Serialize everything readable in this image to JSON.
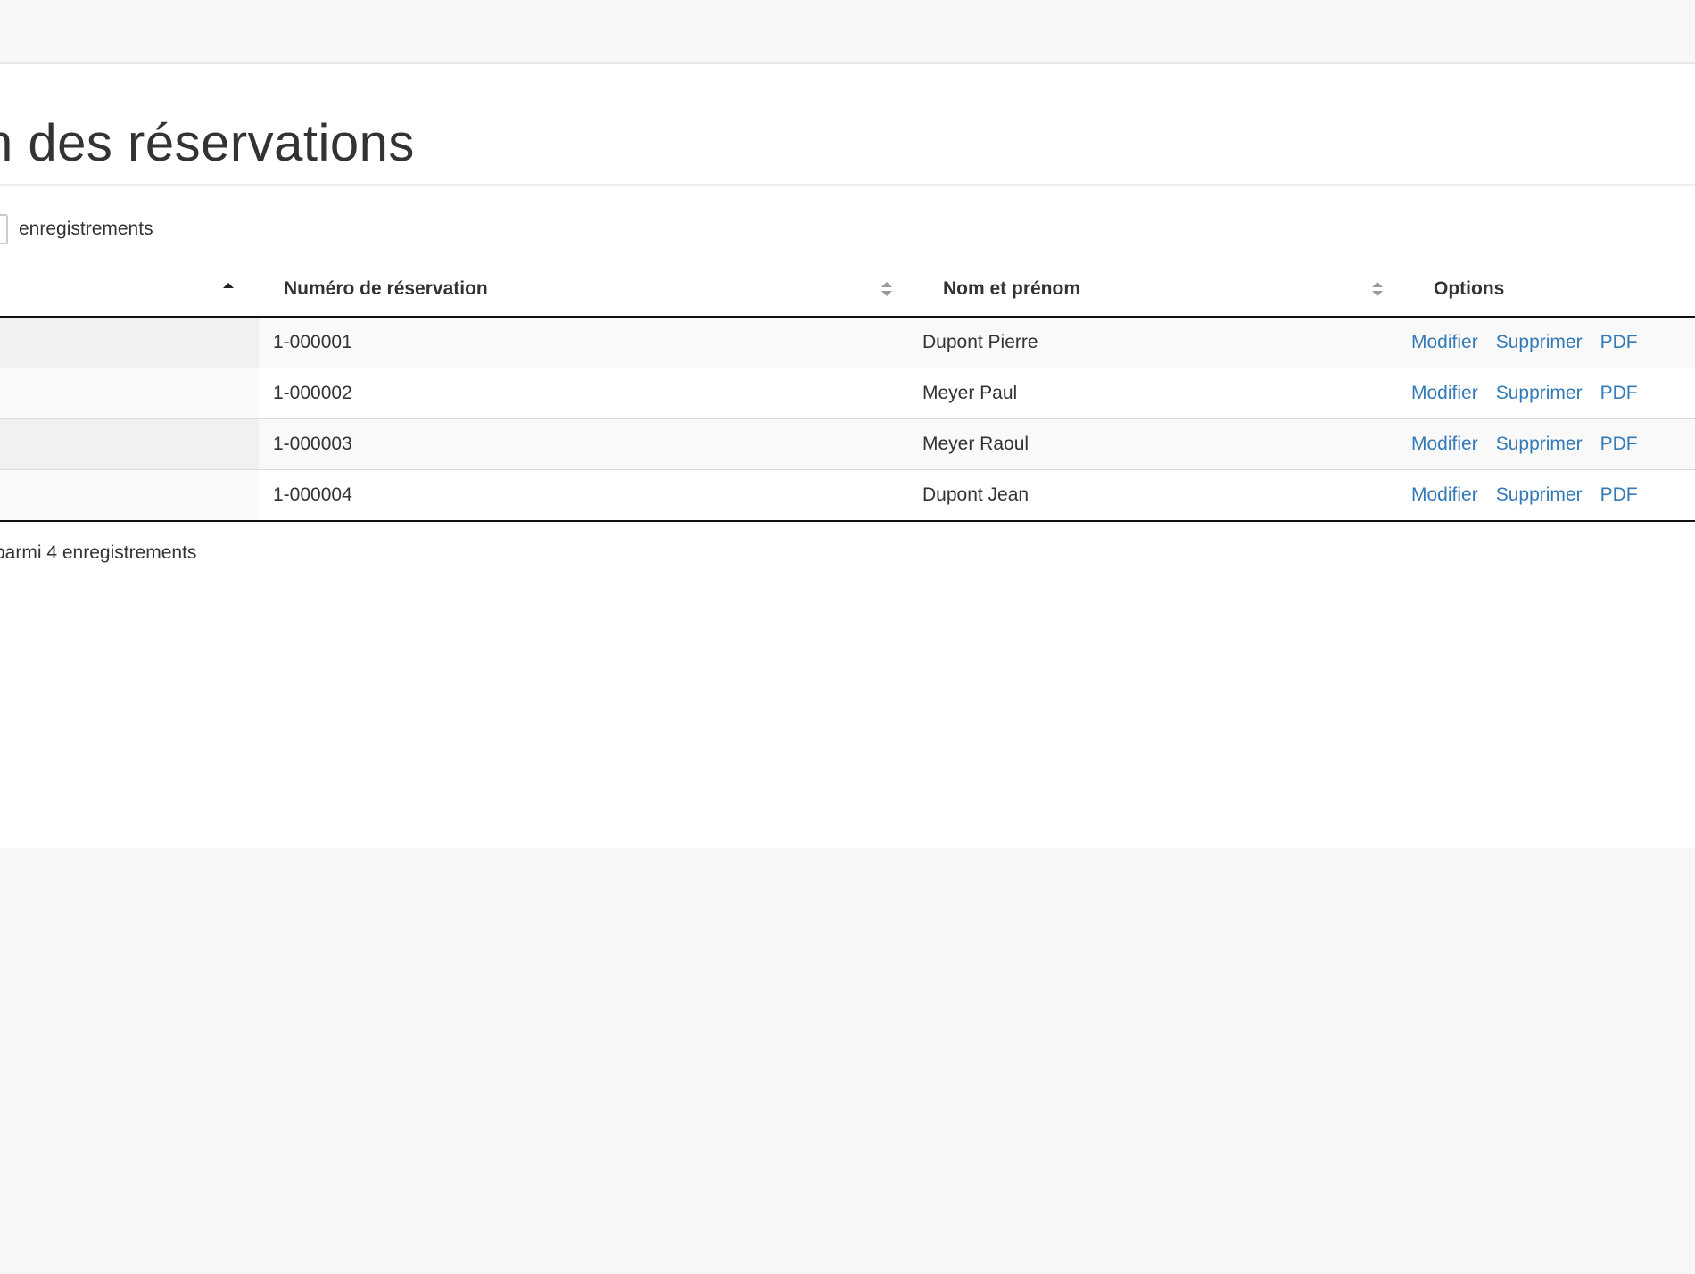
{
  "page": {
    "title": "n des réservations"
  },
  "length_control": {
    "suffix": "enregistrements"
  },
  "table": {
    "columns": [
      {
        "label": "",
        "sort": "asc"
      },
      {
        "label": "Numéro de réservation",
        "sort": "both"
      },
      {
        "label": "Nom et prénom",
        "sort": "both"
      },
      {
        "label": "Options",
        "sort": "none"
      }
    ],
    "rows": [
      {
        "number": "1-000001",
        "name": "Dupont Pierre"
      },
      {
        "number": "1-000002",
        "name": "Meyer Paul"
      },
      {
        "number": "1-000003",
        "name": "Meyer Raoul"
      },
      {
        "number": "1-000004",
        "name": "Dupont Jean"
      }
    ],
    "actions": {
      "edit": "Modifier",
      "delete": "Supprimer",
      "pdf": "PDF"
    }
  },
  "footer": {
    "info": "parmi 4 enregistrements"
  },
  "colors": {
    "link": "#337ab7",
    "background": "#f7f7f7",
    "panel": "#ffffff"
  }
}
